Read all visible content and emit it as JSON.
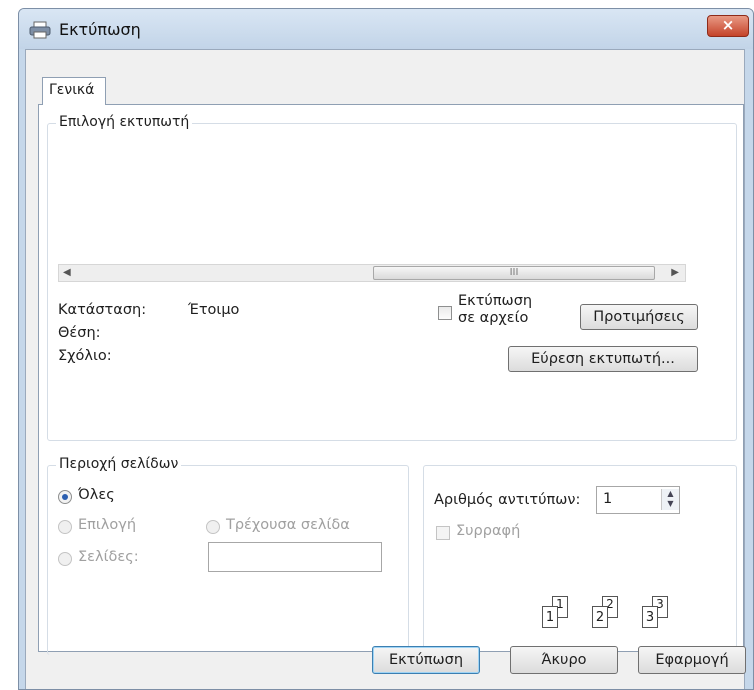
{
  "window": {
    "title": "Εκτύπωση",
    "close_label": "×"
  },
  "tabs": [
    {
      "label": "Γενικά"
    }
  ],
  "printer_group": {
    "title": "Επιλογή εκτυπωτή",
    "scrollbar_thumb_label": "III",
    "status_label": "Κατάσταση:",
    "status_value": "Έτοιμο",
    "location_label": "Θέση:",
    "comment_label": "Σχόλιο:",
    "print_to_file_line1": "Εκτύπωση",
    "print_to_file_line2": "σε αρχείο",
    "preferences_button": "Προτιμήσεις",
    "find_printer_button": "Εύρεση εκτυπωτή..."
  },
  "page_range": {
    "title": "Περιοχή σελίδων",
    "all_label": "Όλες",
    "selection_label": "Επιλογή",
    "current_page_label": "Τρέχουσα σελίδα",
    "pages_label": "Σελίδες:",
    "pages_value": "",
    "selected": "all"
  },
  "copies": {
    "number_label": "Αριθμός αντιτύπων:",
    "number_value": "1",
    "collate_label": "Συρραφή",
    "collate_checked": false,
    "collate_icon_pages": [
      {
        "front": "1",
        "back": "1"
      },
      {
        "front": "2",
        "back": "2"
      },
      {
        "front": "3",
        "back": "3"
      }
    ]
  },
  "footer": {
    "print_button": "Εκτύπωση",
    "cancel_button": "Άκυρο",
    "apply_button": "Εφαρμογή"
  },
  "colors": {
    "title_bar": "#c5d7ea",
    "close_button": "#c4432a",
    "radio_selected": "#2b5fb0"
  }
}
